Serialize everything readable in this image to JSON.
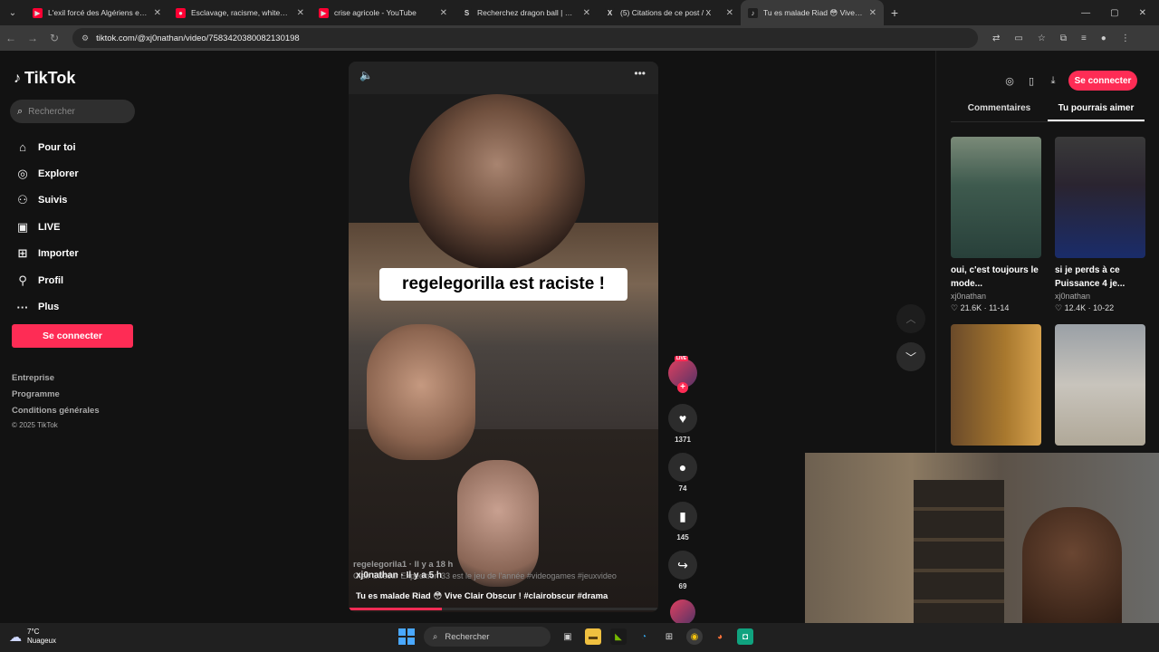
{
  "browser": {
    "tabs": [
      {
        "label": "L'exil forcé des Algériens en No",
        "fav_color": "#ff0033",
        "fav_glyph": "▶"
      },
      {
        "label": "Esclavage, racisme, whitewashi",
        "fav_color": "#ff0033",
        "fav_glyph": "●"
      },
      {
        "label": "crise agricole - YouTube",
        "fav_color": "#ff0033",
        "fav_glyph": "▶"
      },
      {
        "label": "Recherchez dragon ball | Mode",
        "fav_color": "#1f1f1f",
        "fav_glyph": "S"
      },
      {
        "label": "(5) Citations de ce post / X",
        "fav_color": "#1f1f1f",
        "fav_glyph": "X"
      },
      {
        "label": "Tu es malade Riad 😳 Vive Clai",
        "fav_color": "#1f1f1f",
        "fav_glyph": "♪"
      }
    ],
    "new_tab": "+",
    "url": "tiktok.com/@xj0nathan/video/7583420380082130198"
  },
  "sidebar": {
    "logo": "TikTok",
    "search_placeholder": "Rechercher",
    "nav": [
      {
        "label": "Pour toi",
        "icon": "home-icon",
        "glyph": "⌂"
      },
      {
        "label": "Explorer",
        "icon": "compass-icon",
        "glyph": "◎"
      },
      {
        "label": "Suivis",
        "icon": "following-icon",
        "glyph": "⚇"
      },
      {
        "label": "LIVE",
        "icon": "live-icon",
        "glyph": "▣"
      },
      {
        "label": "Importer",
        "icon": "upload-icon",
        "glyph": "⊞"
      },
      {
        "label": "Profil",
        "icon": "profile-icon",
        "glyph": "⚲"
      },
      {
        "label": "Plus",
        "icon": "more-icon",
        "glyph": "···"
      }
    ],
    "login": "Se connecter",
    "footer": [
      "Entreprise",
      "Programme",
      "Conditions générales"
    ],
    "copyright": "© 2025 TikTok"
  },
  "video": {
    "caption": "regelegorilla est raciste !",
    "ghost_user": "regelegorila1 · Il y a 18 h",
    "ghost_desc": "Clair Obscur Expédition 33 est le jeu de l'année #videogames #jeuxvideo",
    "user": "xj0nathan · Il y a 5 h",
    "description": "Tu es malade Riad 😳 Vive Clair Obscur ! #clairobscur #drama",
    "progress": 0.3
  },
  "actions": {
    "live_badge": "LIVE",
    "likes": "1371",
    "comments": "74",
    "saves": "145",
    "shares": "69"
  },
  "right_panel": {
    "login": "Se connecter",
    "tabs": [
      "Commentaires",
      "Tu pourrais aimer"
    ],
    "active_tab": 1,
    "cards": [
      {
        "title": "oui, c'est toujours le mode...",
        "user": "xj0nathan",
        "meta": "♡ 21.6K · 11-14",
        "thumb": "linear-gradient(180deg,#7a8a78 0%,#3e5a4e 40%,#28403a 100%)"
      },
      {
        "title": "si je perds à ce Puissance 4 je...",
        "user": "xj0nathan",
        "meta": "♡ 12.4K · 10-22",
        "thumb": "linear-gradient(180deg,#3a3a3a 0%,#2a2430 40%,#1a2c6a 100%)"
      },
      {
        "title": "",
        "user": "",
        "meta": "",
        "thumb": "linear-gradient(90deg,#6a4a2a 0%,#a8782e 60%,#d6a24e 100%)"
      },
      {
        "title": "",
        "user": "",
        "meta": "",
        "thumb": "linear-gradient(180deg,#9aa0a6 0%,#c8c4bc 50%,#b0a898 100%)"
      }
    ]
  },
  "taskbar": {
    "temp": "7°C",
    "weather": "Nuageux",
    "search": "Rechercher"
  }
}
